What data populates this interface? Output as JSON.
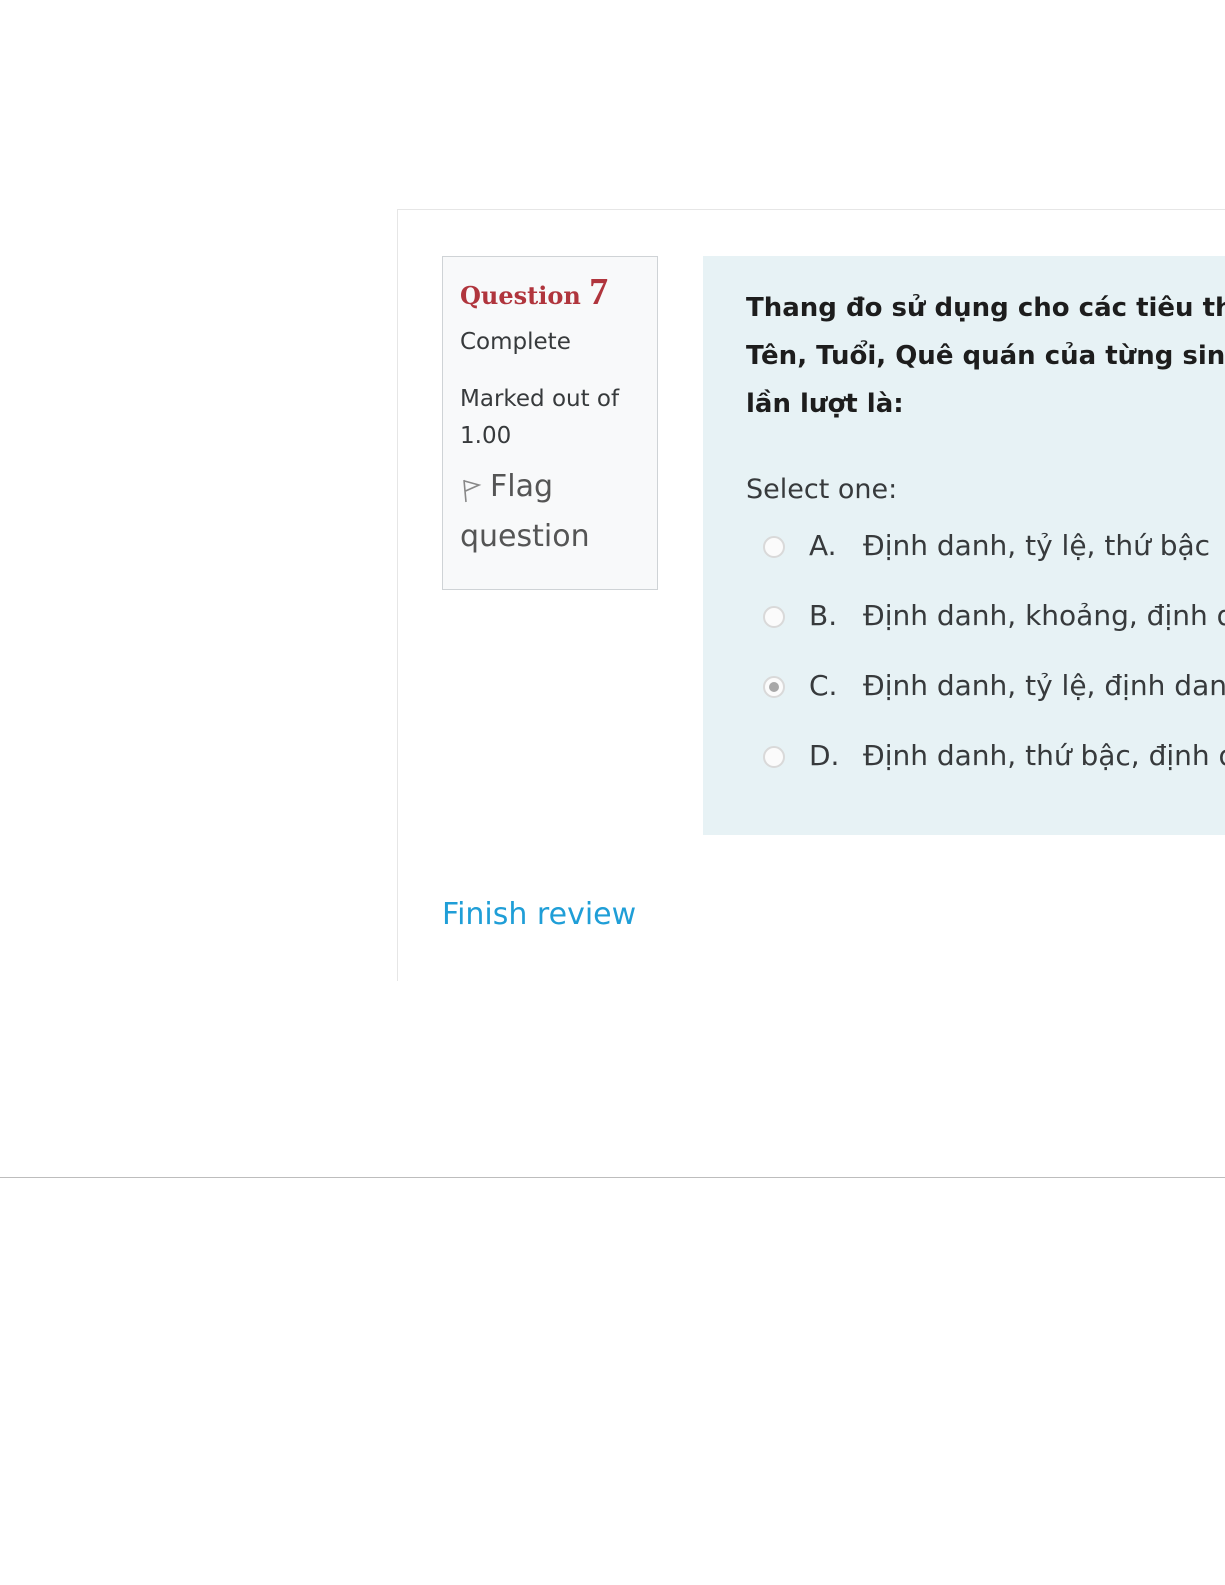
{
  "question_info": {
    "question_label": "Question",
    "question_number": "7",
    "state": "Complete",
    "grade_line1": "Marked out of",
    "grade_line2": "1.00",
    "flag_line1": "Flag",
    "flag_line2": "question"
  },
  "question": {
    "text_lines": [
      "Thang đo sử dụng cho các tiêu th",
      "Tên, Tuổi, Quê quán của từng sin",
      "lần lượt là:"
    ],
    "prompt": "Select one:",
    "answers": [
      {
        "letter": "A.",
        "text": "Định danh, tỷ lệ, thứ bậc",
        "selected": false
      },
      {
        "letter": "B.",
        "text": "Định danh, khoảng, định d",
        "selected": false
      },
      {
        "letter": "C.",
        "text": "Định danh, tỷ lệ, định danh",
        "selected": true
      },
      {
        "letter": "D.",
        "text": "Định danh, thứ bậc, định d",
        "selected": false
      }
    ]
  },
  "navigation": {
    "finish_review": "Finish review"
  },
  "colors": {
    "question_label": "#b0353d",
    "info_background": "#f8f9fa",
    "content_background": "#e7f2f5",
    "link": "#1f9ed7"
  }
}
